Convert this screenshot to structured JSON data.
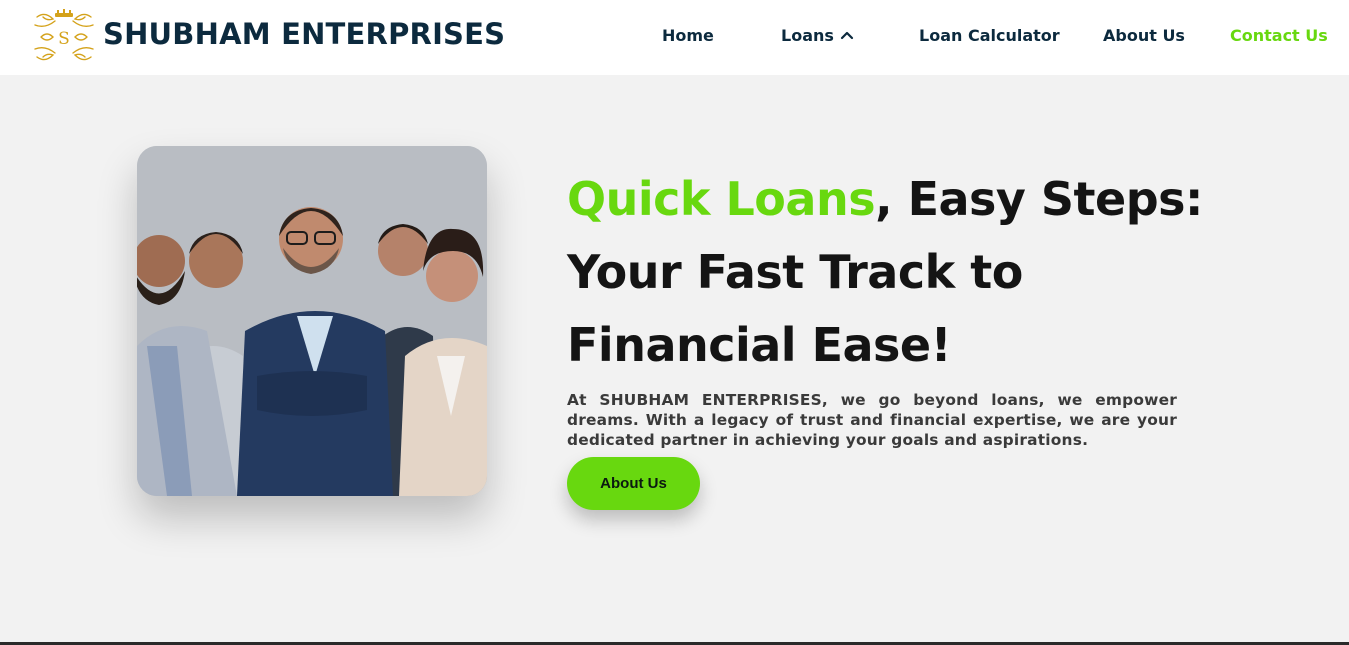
{
  "header": {
    "brand_name": "SHUBHAM ENTERPRISES",
    "logo_icon": "ornate-s-crest-icon",
    "nav": {
      "home": "Home",
      "loans": "Loans",
      "loan_calculator": "Loan Calculator",
      "about_us": "About Us",
      "contact_us": "Contact Us"
    }
  },
  "hero": {
    "headline_accent": "Quick Loans",
    "headline_rest_line1": ", Easy Steps:",
    "headline_line2": "Your Fast Track to",
    "headline_line3": "Financial Ease!",
    "description": "At SHUBHAM ENTERPRISES, we go beyond loans, we empower dreams. With a legacy of trust and financial expertise, we are your dedicated partner in achieving your goals and aspirations.",
    "cta_label": "About Us"
  },
  "colors": {
    "accent": "#68d80f",
    "brand_text": "#0c2a3e",
    "headline_text": "#141414",
    "logo_gold": "#d4a21a"
  }
}
